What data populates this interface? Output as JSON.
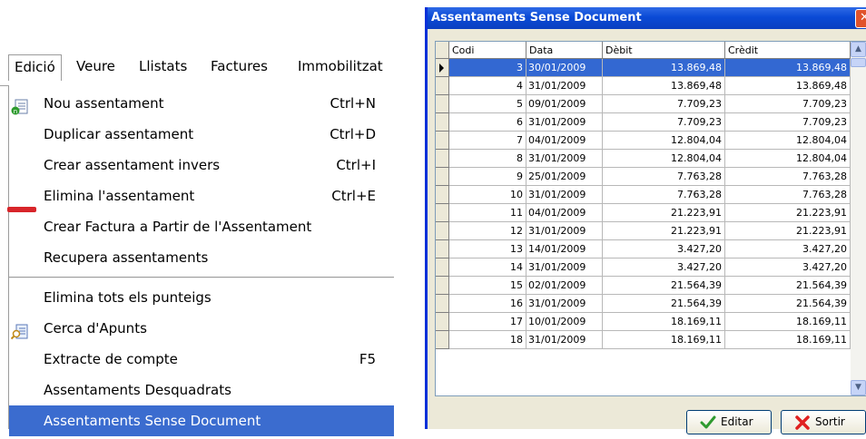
{
  "menubar": {
    "items": [
      "Edició",
      "Veure",
      "Llistats",
      "Factures",
      "Immobilitzat"
    ]
  },
  "menu": {
    "items": [
      {
        "label": "Nou assentament",
        "shortcut": "Ctrl+N",
        "icon": "new-document-icon"
      },
      {
        "label": "Duplicar assentament",
        "shortcut": "Ctrl+D",
        "icon": ""
      },
      {
        "label": "Crear assentament invers",
        "shortcut": "Ctrl+I",
        "icon": ""
      },
      {
        "label": "Elimina l'assentament",
        "shortcut": "Ctrl+E",
        "icon": "minus-bar-icon"
      },
      {
        "label": "Crear Factura a Partir de l'Assentament",
        "shortcut": "",
        "icon": ""
      },
      {
        "label": "Recupera assentaments",
        "shortcut": "",
        "icon": ""
      },
      {
        "label": "Elimina tots els punteigs",
        "shortcut": "",
        "icon": ""
      },
      {
        "label": "Cerca d'Apunts",
        "shortcut": "",
        "icon": "search-document-icon"
      },
      {
        "label": "Extracte de compte",
        "shortcut": "F5",
        "icon": ""
      },
      {
        "label": "Assentaments  Desquadrats",
        "shortcut": "",
        "icon": ""
      },
      {
        "label": "Assentaments Sense Document",
        "shortcut": "",
        "icon": "",
        "selected": true
      }
    ]
  },
  "dialog": {
    "title": "Assentaments Sense Document",
    "columns": [
      "Codi",
      "Data",
      "Dèbit",
      "Crèdit"
    ],
    "rows": [
      [
        "3",
        "30/01/2009",
        "13.869,48",
        "13.869,48"
      ],
      [
        "4",
        "31/01/2009",
        "13.869,48",
        "13.869,48"
      ],
      [
        "5",
        "09/01/2009",
        "7.709,23",
        "7.709,23"
      ],
      [
        "6",
        "31/01/2009",
        "7.709,23",
        "7.709,23"
      ],
      [
        "7",
        "04/01/2009",
        "12.804,04",
        "12.804,04"
      ],
      [
        "8",
        "31/01/2009",
        "12.804,04",
        "12.804,04"
      ],
      [
        "9",
        "25/01/2009",
        "7.763,28",
        "7.763,28"
      ],
      [
        "10",
        "31/01/2009",
        "7.763,28",
        "7.763,28"
      ],
      [
        "11",
        "04/01/2009",
        "21.223,91",
        "21.223,91"
      ],
      [
        "12",
        "31/01/2009",
        "21.223,91",
        "21.223,91"
      ],
      [
        "13",
        "14/01/2009",
        "3.427,20",
        "3.427,20"
      ],
      [
        "14",
        "31/01/2009",
        "3.427,20",
        "3.427,20"
      ],
      [
        "15",
        "02/01/2009",
        "21.564,39",
        "21.564,39"
      ],
      [
        "16",
        "31/01/2009",
        "21.564,39",
        "21.564,39"
      ],
      [
        "17",
        "10/01/2009",
        "18.169,11",
        "18.169,11"
      ],
      [
        "18",
        "31/01/2009",
        "18.169,11",
        "18.169,11"
      ]
    ],
    "selected_row": 0,
    "buttons": {
      "edit": "Editar",
      "exit": "Sortir"
    }
  },
  "colors": {
    "menu_selection": "#3b6ccf",
    "grid_selection": "#3368d2",
    "titlebar": "#0a4ad6",
    "dialog_bg": "#ece9d8"
  }
}
